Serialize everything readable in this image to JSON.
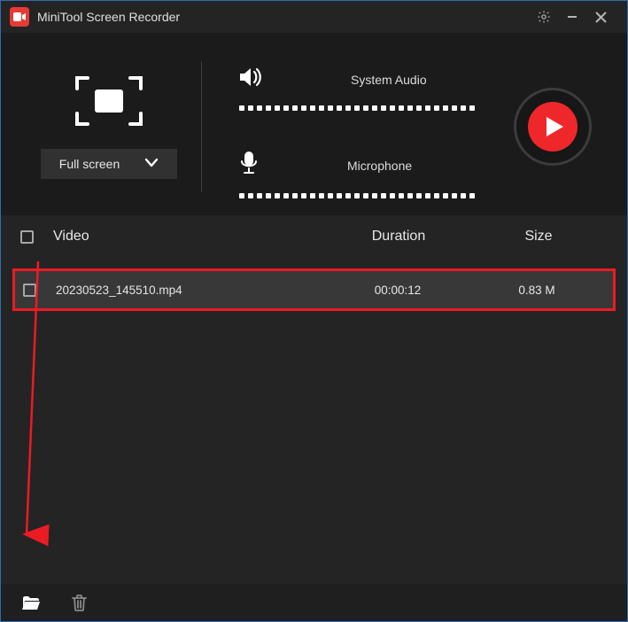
{
  "titlebar": {
    "app_name": "MiniTool Screen Recorder"
  },
  "region": {
    "mode_label": "Full screen"
  },
  "audio": {
    "system_label": "System Audio",
    "mic_label": "Microphone"
  },
  "list": {
    "columns": {
      "video": "Video",
      "duration": "Duration",
      "size": "Size"
    },
    "rows": [
      {
        "filename": "20230523_145510.mp4",
        "duration": "00:00:12",
        "size": "0.83 M"
      }
    ]
  },
  "colors": {
    "accent_red": "#ee272b",
    "highlight_border": "#ec1b23",
    "window_border": "#2f6cb3"
  }
}
